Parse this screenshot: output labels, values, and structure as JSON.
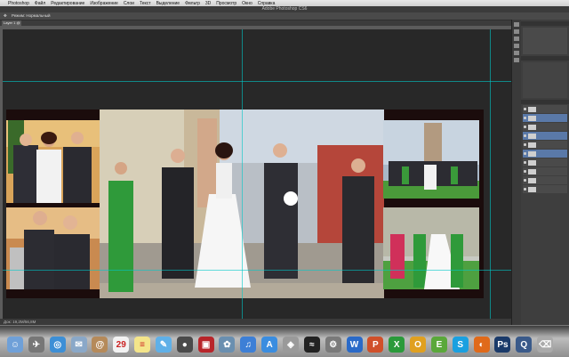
{
  "menubar": {
    "app": "Photoshop",
    "items": [
      "Файл",
      "Редактирование",
      "Изображение",
      "Слои",
      "Текст",
      "Выделение",
      "Фильтр",
      "3D",
      "Просмотр",
      "Окно",
      "Справка"
    ]
  },
  "window": {
    "title": "Adobe Photoshop CS6"
  },
  "options": {
    "mode_label": "Режим: Нормальный"
  },
  "document": {
    "tab_label": "Layer 1 @ 16,7%"
  },
  "status": {
    "zoom": "Док: 19,2М/56,8М"
  },
  "dock": {
    "icons": [
      {
        "name": "finder-icon",
        "color": "#6fa0d8",
        "glyph": "☺"
      },
      {
        "name": "launchpad-icon",
        "color": "#777",
        "glyph": "✈"
      },
      {
        "name": "safari-icon",
        "color": "#3d8fd6",
        "glyph": "◎"
      },
      {
        "name": "mail-icon",
        "color": "#8aa8c8",
        "glyph": "✉"
      },
      {
        "name": "contacts-icon",
        "color": "#b58a5a",
        "glyph": "@"
      },
      {
        "name": "calendar-icon",
        "color": "#f2f2f2",
        "glyph": "29"
      },
      {
        "name": "notes-icon",
        "color": "#f4e58a",
        "glyph": "≡"
      },
      {
        "name": "messages-icon",
        "color": "#5fb0e8",
        "glyph": "✎"
      },
      {
        "name": "facetime-icon",
        "color": "#4a4a4a",
        "glyph": "●"
      },
      {
        "name": "photo-booth-icon",
        "color": "#b8252a",
        "glyph": "▣"
      },
      {
        "name": "iphoto-icon",
        "color": "#6a8fb0",
        "glyph": "✿"
      },
      {
        "name": "itunes-icon",
        "color": "#3d7fd6",
        "glyph": "♫"
      },
      {
        "name": "app-store-icon",
        "color": "#3a8de0",
        "glyph": "A"
      },
      {
        "name": "preview-icon",
        "color": "#9a9a9a",
        "glyph": "◈"
      },
      {
        "name": "activity-monitor-icon",
        "color": "#222",
        "glyph": "≈"
      },
      {
        "name": "system-preferences-icon",
        "color": "#7a7a7a",
        "glyph": "⚙"
      },
      {
        "name": "word-icon",
        "color": "#2a6ac8",
        "glyph": "W"
      },
      {
        "name": "powerpoint-icon",
        "color": "#d0502a",
        "glyph": "P"
      },
      {
        "name": "excel-icon",
        "color": "#2a9a3a",
        "glyph": "X"
      },
      {
        "name": "outlook-icon",
        "color": "#e0a020",
        "glyph": "O"
      },
      {
        "name": "evernote-icon",
        "color": "#5aa83a",
        "glyph": "E"
      },
      {
        "name": "skype-icon",
        "color": "#1aa0e0",
        "glyph": "S"
      },
      {
        "name": "firefox-icon",
        "color": "#e06a1a",
        "glyph": "◐"
      },
      {
        "name": "photoshop-icon",
        "color": "#1a3a6a",
        "glyph": "Ps"
      },
      {
        "name": "quicktime-icon",
        "color": "#3a5a8a",
        "glyph": "Q"
      },
      {
        "name": "trash-icon",
        "color": "#aaa",
        "glyph": "⌫"
      }
    ]
  }
}
